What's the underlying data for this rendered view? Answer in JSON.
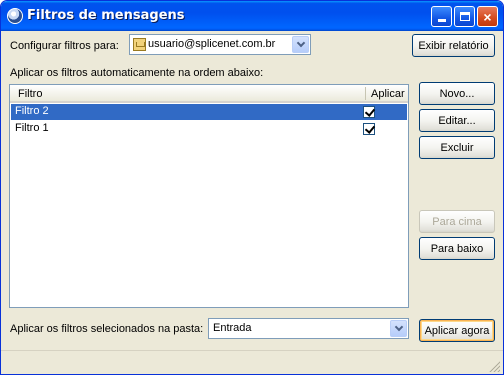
{
  "window": {
    "title": "Filtros de mensagens",
    "icon": "thunderbird-icon",
    "controls": {
      "minimize": "minimize-icon",
      "maximize": "maximize-icon",
      "close": "×"
    }
  },
  "account": {
    "label": "Configurar filtros para:",
    "selected": "usuario@splicenet.com.br",
    "icon": "mail-account-icon"
  },
  "buttons": {
    "show_log": "Exibir relatório",
    "new": "Novo...",
    "edit": "Editar...",
    "delete": "Excluir",
    "move_up": "Para cima",
    "move_down": "Para baixo",
    "apply_now": "Aplicar agora"
  },
  "list": {
    "caption": "Aplicar os filtros automaticamente na ordem abaixo:",
    "columns": {
      "name": "Filtro",
      "apply": "Aplicar"
    },
    "rows": [
      {
        "name": "Filtro 2",
        "enabled": true,
        "selected": true
      },
      {
        "name": "Filtro 1",
        "enabled": true,
        "selected": false
      }
    ]
  },
  "folder": {
    "label": "Aplicar os filtros selecionados na pasta:",
    "selected": "Entrada"
  },
  "colors": {
    "titlebar": "#0053ee",
    "selection": "#316ac5",
    "dialog_bg": "#ece9d8"
  }
}
